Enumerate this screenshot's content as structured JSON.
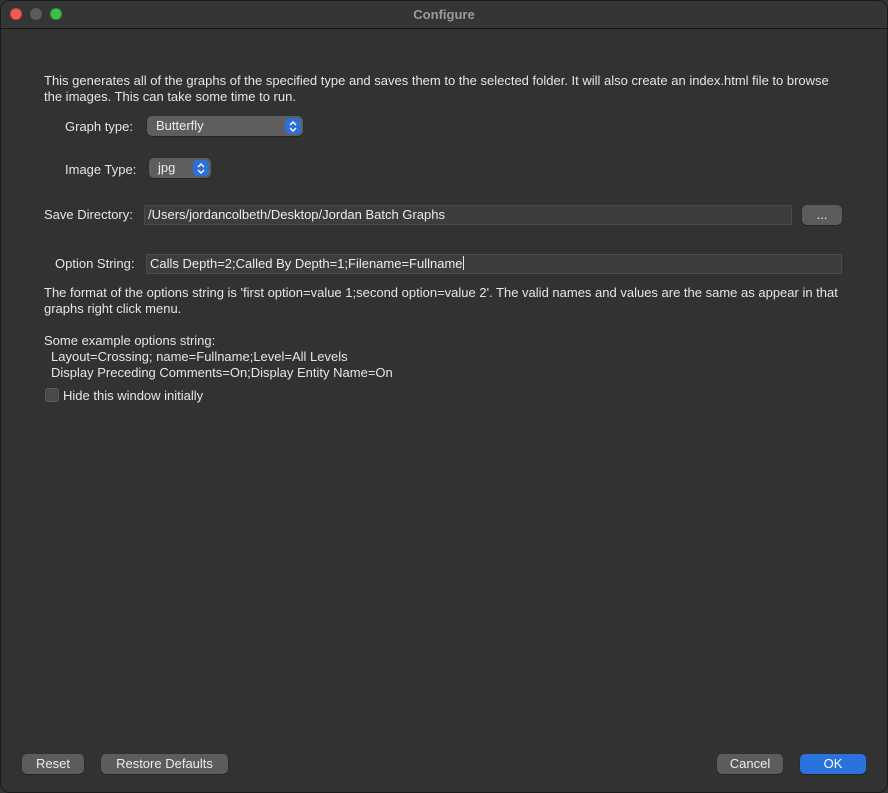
{
  "window": {
    "title": "Configure"
  },
  "description": "This generates all of the graphs of the specified type and saves them to the selected folder. It will also create an index.html file to browse the images. This can take some time to run.",
  "graph_type": {
    "label": "Graph type:",
    "value": "Butterfly"
  },
  "image_type": {
    "label": "Image Type:",
    "value": "jpg"
  },
  "save_directory": {
    "label": "Save Directory:",
    "value": "/Users/jordancolbeth/Desktop/Jordan Batch Graphs",
    "browse_label": "..."
  },
  "option_string": {
    "label": "Option String:",
    "value": "Calls Depth=2;Called By Depth=1;Filename=Fullname"
  },
  "format_help": "The format of the options string is 'first option=value 1;second option=value 2'. The valid names and values are the same as appear in that graphs right click menu.",
  "examples": {
    "heading": "Some example options string:",
    "lines": [
      "Layout=Crossing; name=Fullname;Level=All Levels",
      "Display Preceding Comments=On;Display Entity Name=On"
    ]
  },
  "hide_window": {
    "label": "Hide this window initially",
    "checked": false
  },
  "buttons": {
    "reset": "Reset",
    "restore_defaults": "Restore Defaults",
    "cancel": "Cancel",
    "ok": "OK"
  },
  "colors": {
    "accent": "#2a72dc",
    "close": "#ee5c57",
    "maximize": "#3fbf47"
  }
}
